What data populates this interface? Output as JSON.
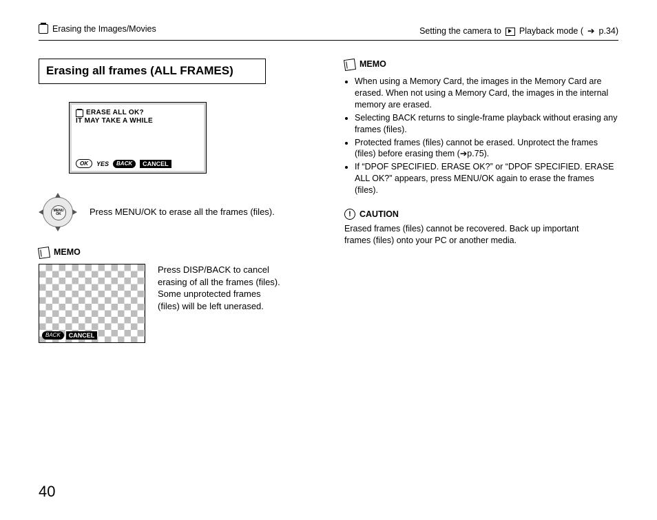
{
  "header": {
    "left_label": "Erasing the Images/Movies",
    "right_prefix": "Setting the camera to ",
    "right_mode": " Playback mode (",
    "right_arrow": "➔",
    "right_page": "p.34)"
  },
  "section_title": "Erasing all frames (ALL FRAMES)",
  "lcd1": {
    "line1": "ERASE ALL OK?",
    "line2": "IT MAY TAKE A WHILE",
    "ok_pill": "OK",
    "yes": "YES",
    "back_pill": "BACK",
    "cancel": "CANCEL"
  },
  "dpad": {
    "center": "MENU\nOK"
  },
  "instr1": "Press MENU/OK to erase all the frames (files).",
  "memo_label": "MEMO",
  "instr2": "Press DISP/BACK to cancel erasing of all the frames (files). Some unprotected frames (files) will be left unerased.",
  "checker": {
    "back_pill": "BACK",
    "cancel": "CANCEL"
  },
  "memo_right_label": "MEMO",
  "memo_items": [
    "When using a Memory Card, the images in the Memory Card are erased. When not using a Memory Card, the images in the internal memory are erased.",
    "Selecting BACK returns to single-frame playback without erasing any frames (files).",
    "Protected frames (files) cannot be erased. Unprotect the frames (files) before erasing them (➔p.75).",
    "If “DPOF SPECIFIED. ERASE OK?” or “DPOF SPECIFIED. ERASE ALL OK?” appears, press MENU/OK again to erase the frames (files)."
  ],
  "caution_label": "CAUTION",
  "caution_body": "Erased frames (files) cannot be recovered. Back up important frames (files) onto your PC or another media.",
  "page_number": "40"
}
